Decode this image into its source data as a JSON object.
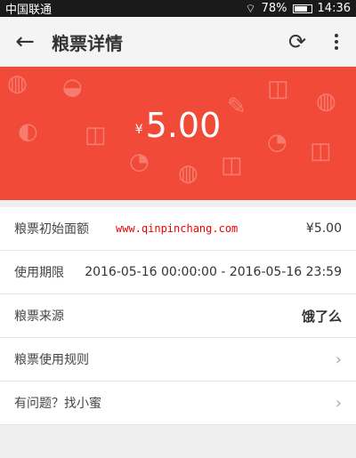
{
  "status_bar": {
    "carrier": "中国联通",
    "battery": "78%",
    "time": "14:36"
  },
  "app_bar": {
    "title": "粮票详情",
    "back_icon": "arrow-left-icon",
    "refresh_icon": "refresh-icon",
    "more_icon": "more-vert-icon"
  },
  "voucher": {
    "currency_symbol": "¥",
    "amount": "5.00",
    "accent_color": "#f24a38"
  },
  "details": {
    "face_value_label": "粮票初始面额",
    "face_value": "¥5.00",
    "watermark": "www.qinpinchang.com",
    "validity_label": "使用期限",
    "validity_value": "2016-05-16 00:00:00 - 2016-05-16 23:59",
    "source_label": "粮票来源",
    "source_value": "饿了么",
    "rules_label": "粮票使用规则",
    "help_label": "有问题？找小蜜"
  }
}
